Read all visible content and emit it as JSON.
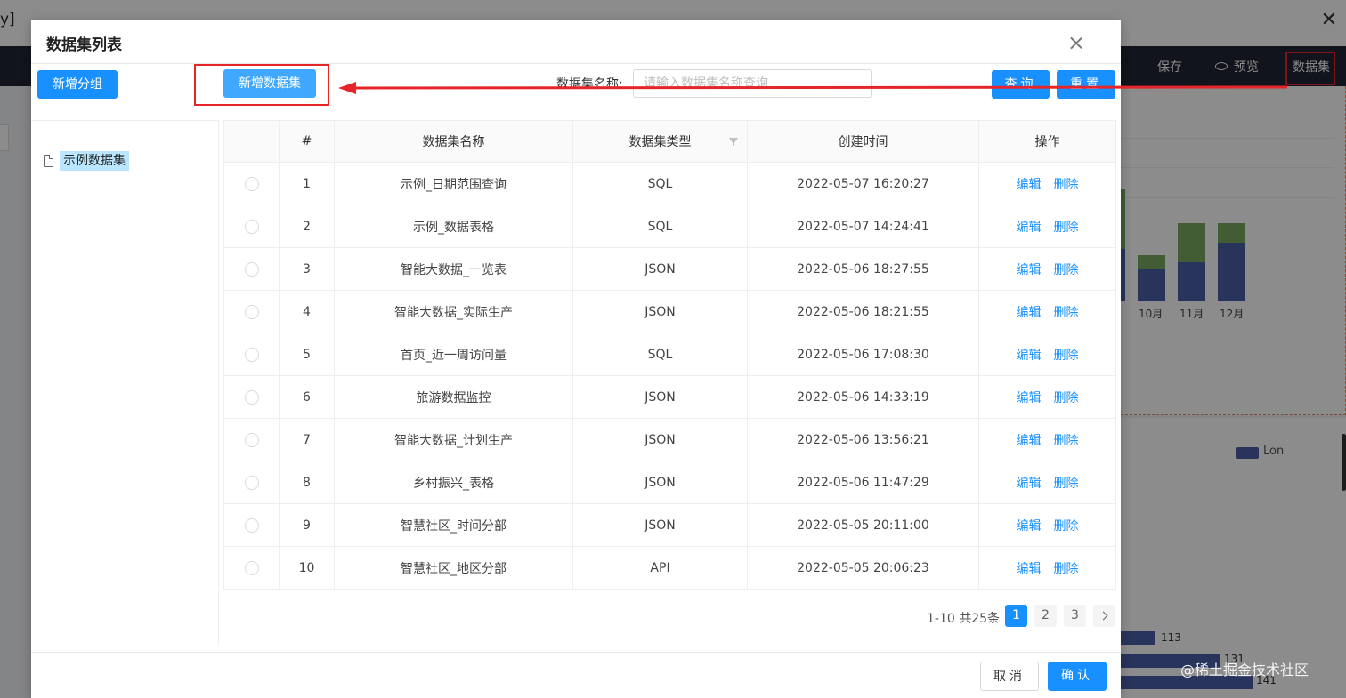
{
  "background": {
    "window_title": "y]",
    "nav": {
      "save_label": "保存",
      "preview_label": "预览",
      "dataset_label": "数据集"
    },
    "chart": {
      "months": [
        "10月",
        "11月",
        "12月"
      ],
      "legend": "Lon",
      "bar_values": [
        "113",
        "131",
        "141"
      ]
    },
    "watermark": "@稀土掘金技术社区"
  },
  "dialog": {
    "title": "数据集列表",
    "add_group_label": "新增分组",
    "add_dataset_label": "新增数据集",
    "tree": {
      "items": [
        {
          "label": "示例数据集"
        }
      ]
    },
    "search": {
      "label": "数据集名称:",
      "placeholder": "请输入数据集名称查询",
      "query_label": "查询",
      "reset_label": "重置"
    },
    "table": {
      "columns": [
        "",
        "#",
        "数据集名称",
        "数据集类型",
        "创建时间",
        "操作"
      ],
      "rows": [
        {
          "index": "1",
          "name": "示例_日期范围查询",
          "type": "SQL",
          "created": "2022-05-07 16:20:27"
        },
        {
          "index": "2",
          "name": "示例_数据表格",
          "type": "SQL",
          "created": "2022-05-07 14:24:41"
        },
        {
          "index": "3",
          "name": "智能大数据_一览表",
          "type": "JSON",
          "created": "2022-05-06 18:27:55"
        },
        {
          "index": "4",
          "name": "智能大数据_实际生产",
          "type": "JSON",
          "created": "2022-05-06 18:21:55"
        },
        {
          "index": "5",
          "name": "首页_近一周访问量",
          "type": "SQL",
          "created": "2022-05-06 17:08:30"
        },
        {
          "index": "6",
          "name": "旅游数据监控",
          "type": "JSON",
          "created": "2022-05-06 14:33:19"
        },
        {
          "index": "7",
          "name": "智能大数据_计划生产",
          "type": "JSON",
          "created": "2022-05-06 13:56:21"
        },
        {
          "index": "8",
          "name": "乡村振兴_表格",
          "type": "JSON",
          "created": "2022-05-06 11:47:29"
        },
        {
          "index": "9",
          "name": "智慧社区_时间分部",
          "type": "JSON",
          "created": "2022-05-05 20:11:00"
        },
        {
          "index": "10",
          "name": "智慧社区_地区分部",
          "type": "API",
          "created": "2022-05-05 20:06:23"
        }
      ],
      "edit_label": "编辑",
      "delete_label": "删除"
    },
    "pagination": {
      "total_text": "1-10 共25条",
      "pages": [
        "1",
        "2",
        "3"
      ],
      "current_page": "1"
    },
    "cancel_label": "取消",
    "ok_label": "确认"
  },
  "colors": {
    "primary": "#1890ff",
    "annotation_red": "#e5252a",
    "nav_dark": "#1f2533"
  }
}
